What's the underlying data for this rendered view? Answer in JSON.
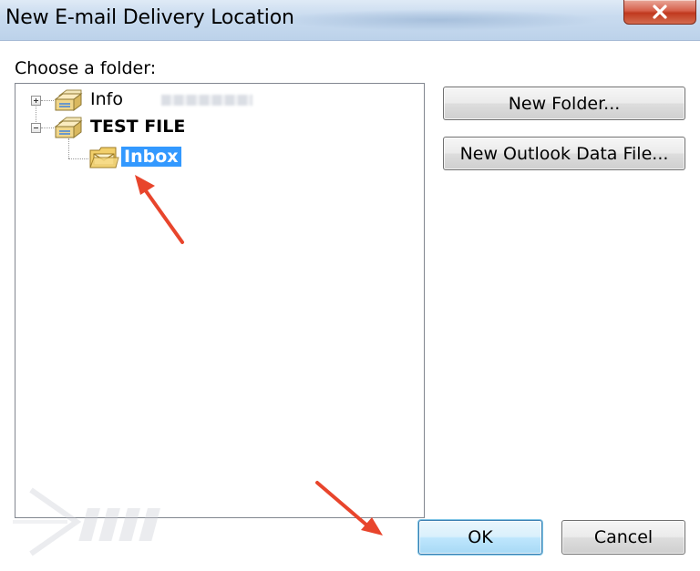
{
  "window": {
    "title": "New E-mail Delivery Location"
  },
  "dialog": {
    "choose_label": "Choose a folder:"
  },
  "tree": {
    "nodes": [
      {
        "label": "Info",
        "expanded": false,
        "icon": "data-file-icon"
      },
      {
        "label": "TEST FILE",
        "expanded": true,
        "icon": "data-file-icon"
      },
      {
        "label": "Inbox",
        "selected": true,
        "icon": "inbox-folder-icon"
      }
    ]
  },
  "buttons": {
    "new_folder": "New Folder...",
    "new_data_file": "New Outlook Data File...",
    "ok": "OK",
    "cancel": "Cancel"
  },
  "colors": {
    "selection": "#3399ff",
    "annotation_arrow": "#e8452c",
    "close_button": "#c9452e"
  }
}
